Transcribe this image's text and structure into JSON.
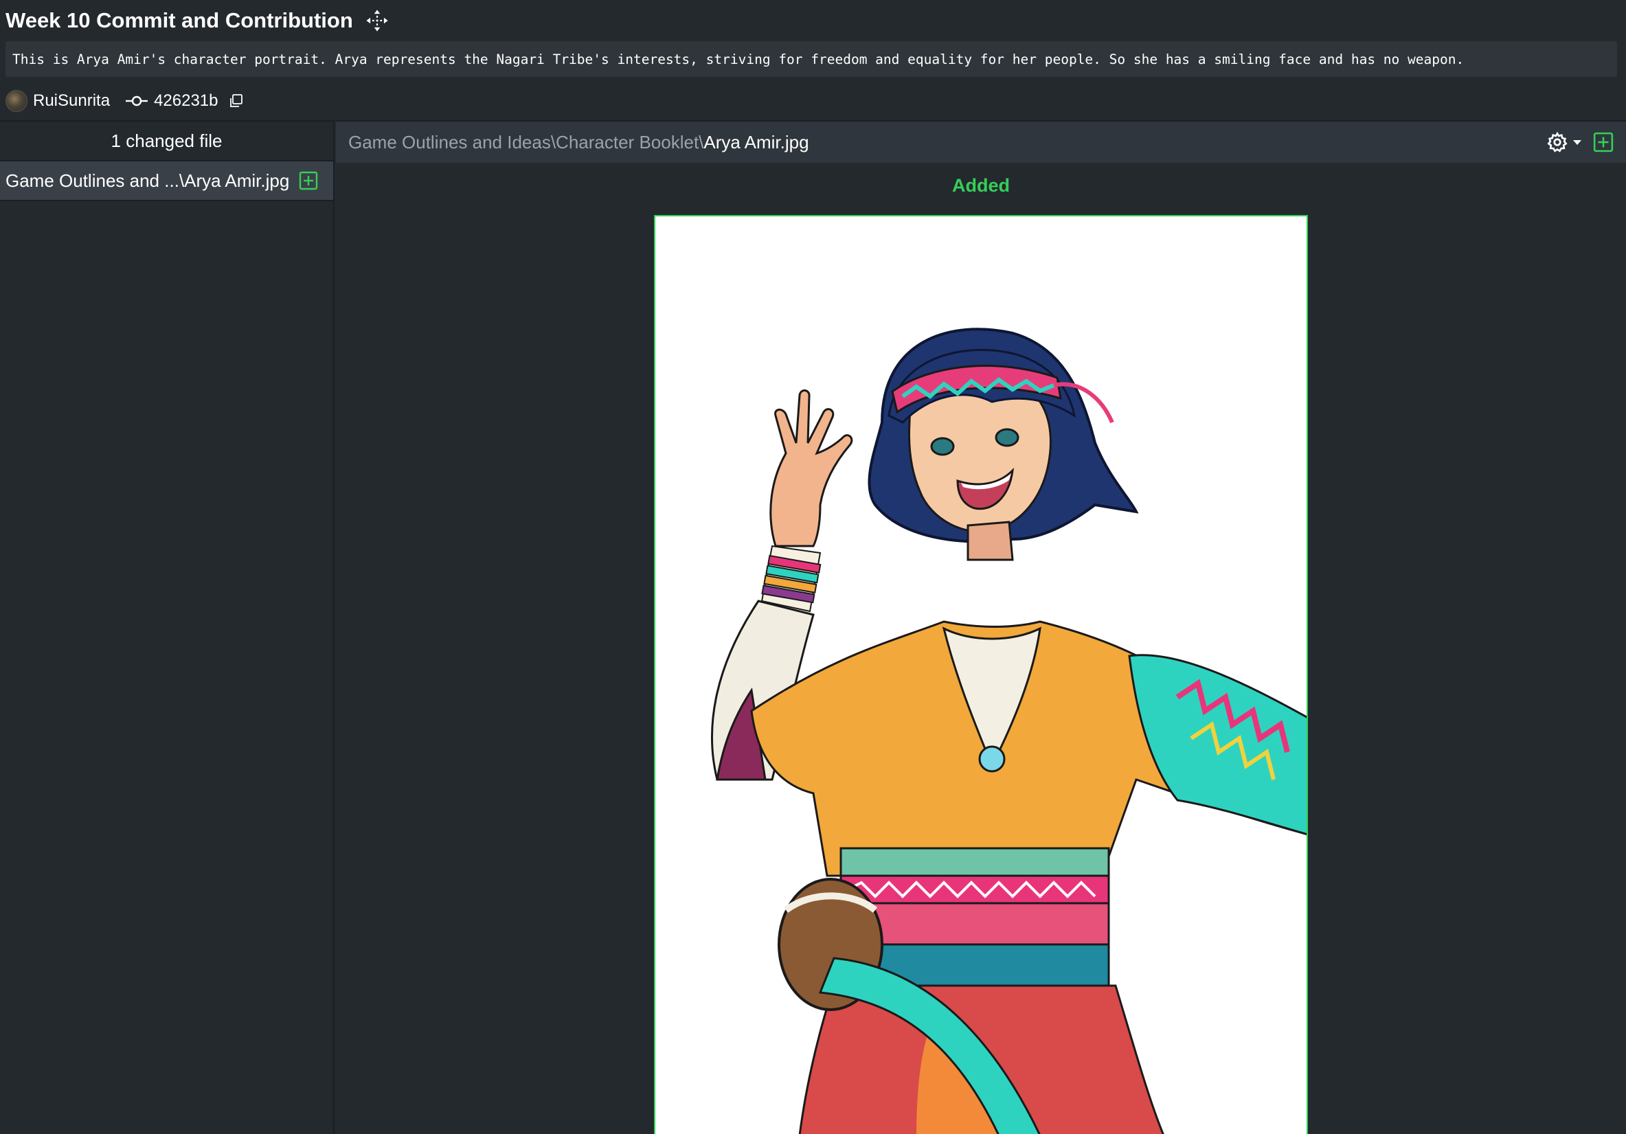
{
  "commit": {
    "title": "Week 10 Commit and Contribution",
    "message": "This is Arya Amir's character portrait. Arya represents the Nagari Tribe's interests, striving for freedom and equality for her people. So she has a smiling face and has no weapon.",
    "author": "RuiSunrita",
    "sha": "426231b"
  },
  "sidebar": {
    "header": "1 changed file",
    "files": [
      {
        "label": "Game Outlines and ...\\Arya Amir.jpg",
        "status_icon": "plus-square-icon"
      }
    ]
  },
  "viewer": {
    "path_dir": "Game Outlines and Ideas\\Character Booklet\\",
    "path_file": "Arya Amir.jpg",
    "status": "Added"
  },
  "icons": {
    "move": "move-icon",
    "commit": "commit-icon",
    "copy": "copy-icon",
    "gear": "gear-icon",
    "caret": "caret-down-icon",
    "add": "plus-square-icon"
  },
  "colors": {
    "background": "#24292e",
    "panel": "#2f363d",
    "selected_item": "#3a4047",
    "added_green": "#34d058",
    "muted_text": "#9aa3ad"
  }
}
